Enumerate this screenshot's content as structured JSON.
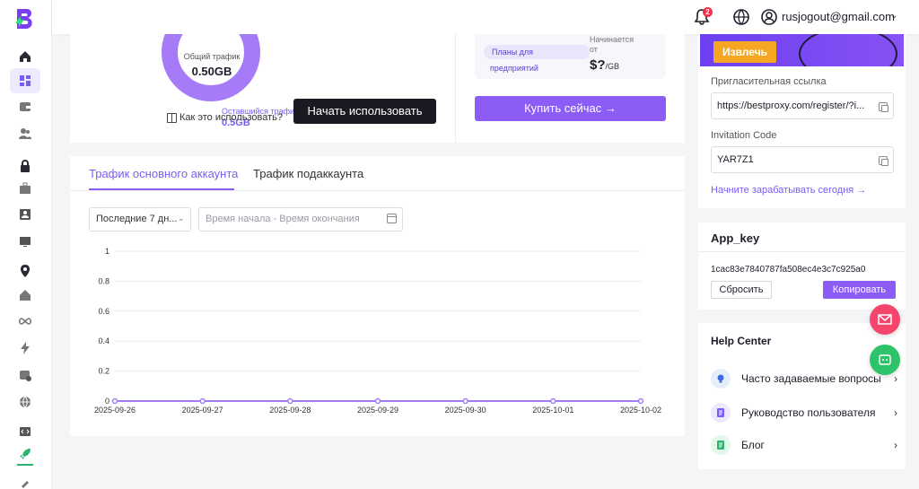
{
  "header": {
    "notification_count": "2",
    "user_email": "rusjogout@gmail.com"
  },
  "traffic_summary": {
    "total_label": "Общий трафик",
    "total_value": "0.50GB",
    "remaining_label": "Оставшийся трафик",
    "remaining_value": "0.5GB",
    "howto_label": "Как это использовать?",
    "start_button": "Начать использовать"
  },
  "plans": {
    "pill_line1": "Планы для",
    "pill_line2": "предприятий",
    "starts_from": "Начинается от",
    "price": "$?",
    "price_unit": "/GB",
    "buy_button": "Купить сейчас →"
  },
  "traffic_tabs": {
    "main": "Трафик основного аккаунта",
    "sub": "Трафик подаккаунта"
  },
  "filters": {
    "period": "Последние 7 дн...",
    "date_placeholder": "Время начала - Время окончания"
  },
  "chart_data": {
    "type": "line",
    "x": [
      "2025-09-26",
      "2025-09-27",
      "2025-09-28",
      "2025-09-29",
      "2025-09-30",
      "2025-10-01",
      "2025-10-02"
    ],
    "series": [
      {
        "values": [
          0,
          0,
          0,
          0,
          0,
          0,
          0
        ]
      }
    ],
    "ylim": [
      0,
      1
    ],
    "yticks": [
      "0",
      "0.2",
      "0.4",
      "0.6",
      "0.8",
      "1"
    ],
    "grid": true,
    "color": "#a57bf8"
  },
  "referral": {
    "extract_button": "Извлечь",
    "link_label": "Пригласительная ссылка",
    "link_value": "https://bestproxy.com/register/?i...",
    "code_label": "Invitation Code",
    "code_value": "YAR7Z1",
    "earn_link": "Начните зарабатывать сегодня →"
  },
  "app_key": {
    "title": "App_key",
    "value": "1cac83e7840787fa508ec4e3c7c925a0",
    "reset_button": "Сбросить",
    "copy_button": "Копировать"
  },
  "help_center": {
    "title": "Help Center",
    "items": [
      {
        "label": "Часто задаваемые вопросы",
        "icon": "lightbulb-icon"
      },
      {
        "label": "Руководство пользователя",
        "icon": "document-icon"
      },
      {
        "label": "Блог",
        "icon": "blog-icon"
      }
    ]
  },
  "colors": {
    "accent": "#8b5cf6",
    "accent_text": "#7b5cf5",
    "dark_button": "#1a1a22",
    "orange": "#f5a623",
    "mail_fab": "#f4456d",
    "bot_fab": "#2dc36a"
  },
  "sidebar": {
    "icons": [
      "home-icon",
      "dashboard-icon",
      "wallet-icon",
      "users-icon",
      "lock-icon",
      "briefcase-icon",
      "contact-icon",
      "monitor-icon",
      "location-icon",
      "house-icon",
      "infinity-icon",
      "lightning-icon",
      "database-icon",
      "globe-icon",
      "code-icon",
      "rocket-icon",
      "satellite-icon"
    ]
  }
}
